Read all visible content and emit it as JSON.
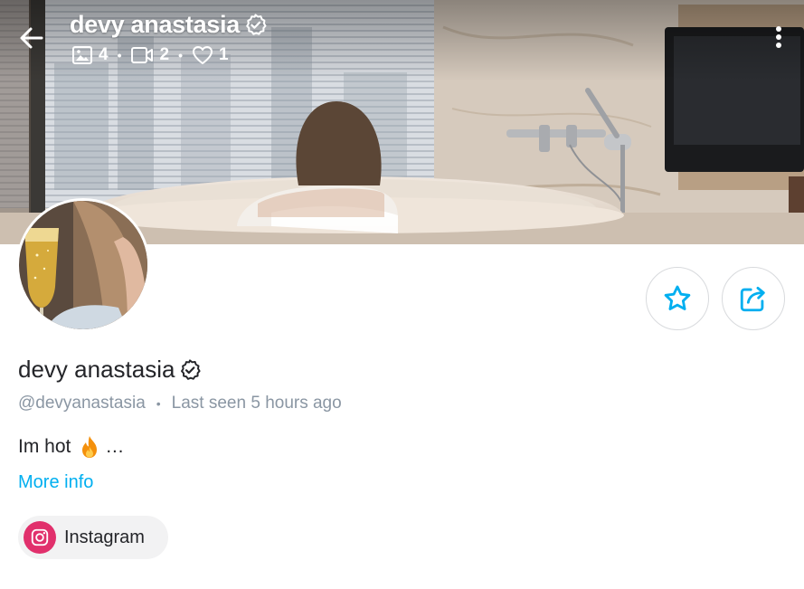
{
  "header": {
    "title": "devy anastasia",
    "stats": {
      "photos": "4",
      "videos": "2",
      "likes": "1"
    },
    "stat_separator": "•"
  },
  "profile": {
    "name": "devy anastasia",
    "username": "@devyanastasia",
    "meta_separator": "•",
    "last_seen": "Last seen 5 hours ago",
    "bio": "Im hot",
    "bio_suffix": "…",
    "more_info_label": "More info"
  },
  "social_links": [
    {
      "network": "Instagram",
      "label": "Instagram",
      "icon": "instagram-icon"
    }
  ],
  "icons": {
    "back": "back-arrow-icon",
    "verified": "verified-badge-icon",
    "photos": "image-icon",
    "videos": "video-icon",
    "likes": "heart-icon",
    "more": "kebab-menu-icon",
    "favorite": "star-icon",
    "share": "share-icon",
    "fire": "fire-emoji-icon"
  },
  "colors": {
    "accent": "#00aff0",
    "text_primary": "#242529",
    "text_secondary": "#8a96a3",
    "instagram": "#e1306c",
    "chip_bg": "#f2f2f3"
  }
}
